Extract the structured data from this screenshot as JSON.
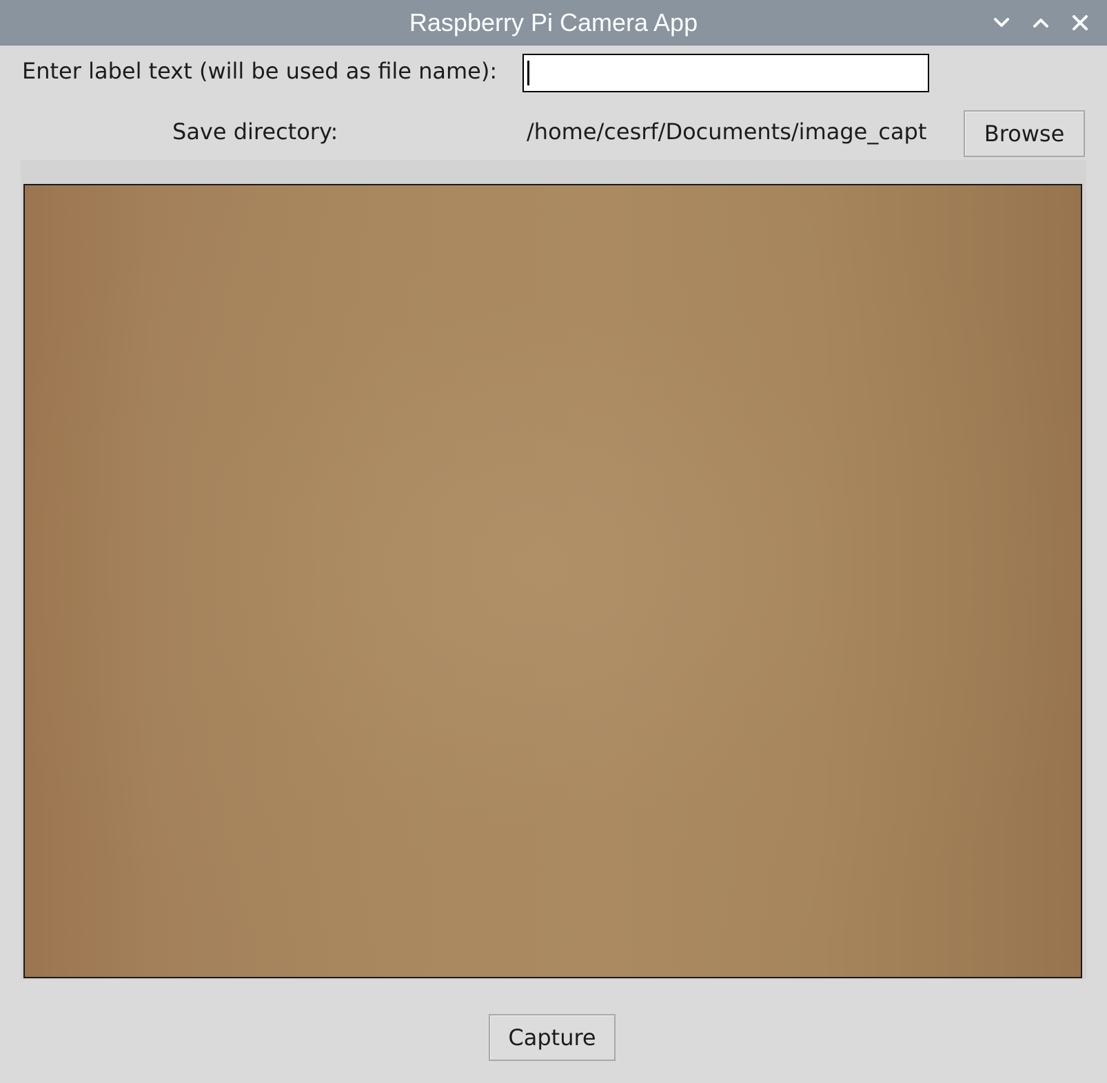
{
  "window": {
    "title": "Raspberry Pi Camera App"
  },
  "form": {
    "label_prompt": "Enter label text (will be used as file name):",
    "label_value": "",
    "save_directory_label": "Save directory:",
    "save_directory_path": "/home/cesrf/Documents/image_captures",
    "browse_label": "Browse"
  },
  "preview": {
    "icon": "camera-preview"
  },
  "actions": {
    "capture_label": "Capture"
  },
  "colors": {
    "titlebar": "#8a949f",
    "window_bg": "#dadada",
    "preview_tone": "#a7865d"
  }
}
